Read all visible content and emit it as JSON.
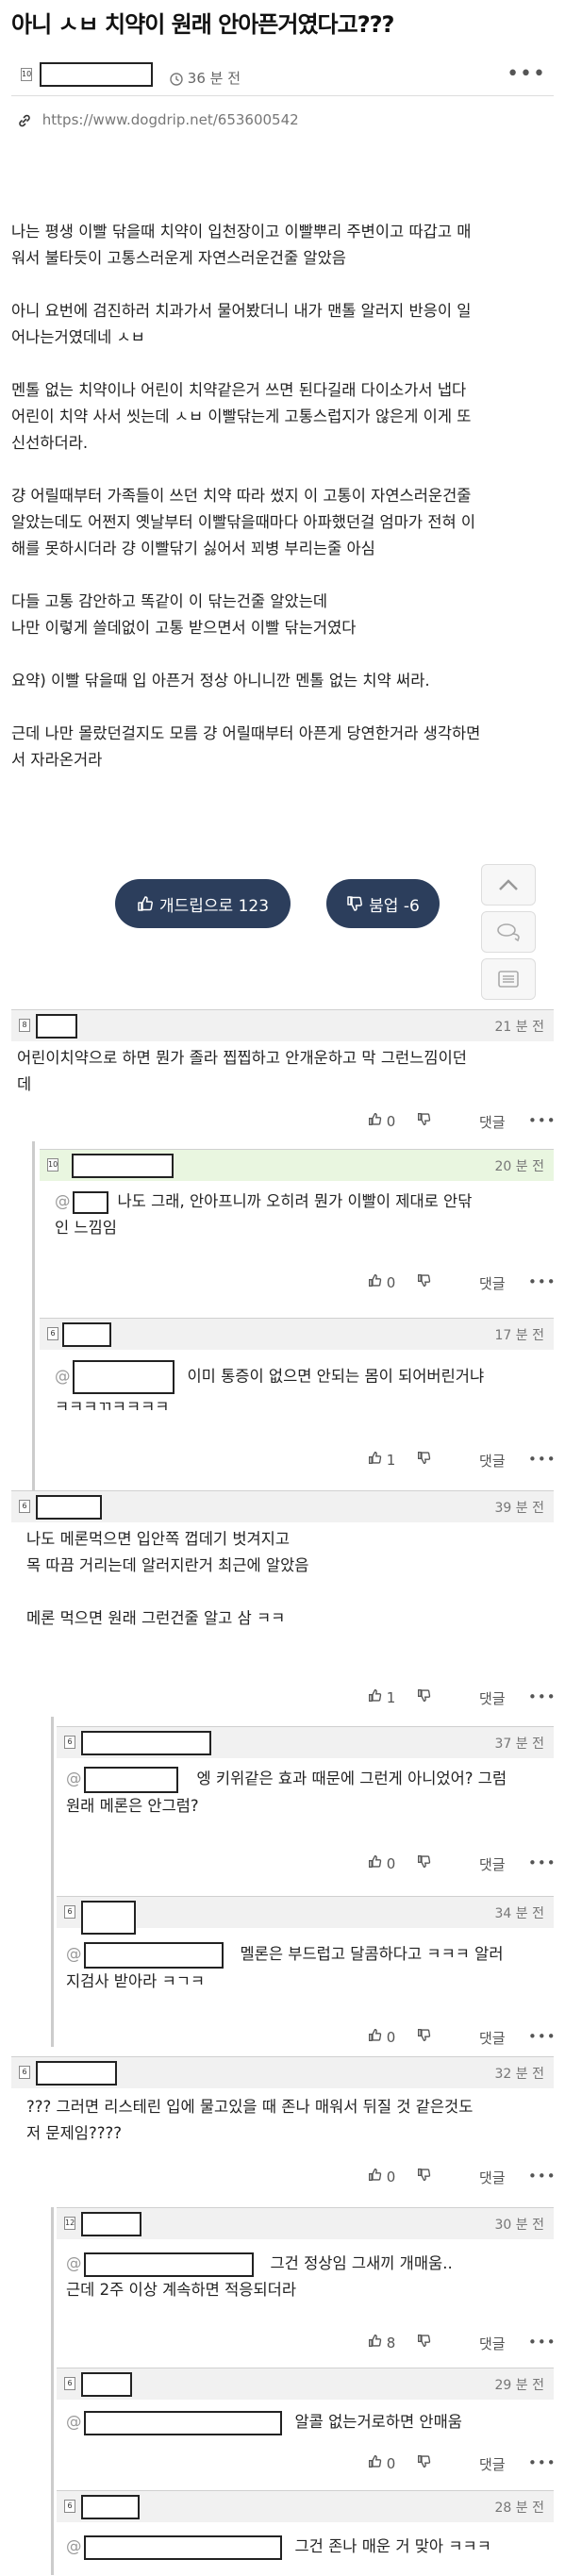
{
  "post": {
    "title": "아니 ㅅㅂ 치약이 원래 안아픈거였다고???",
    "level": "10",
    "time": "36 분 전",
    "url": "https://www.dogdrip.net/653600542",
    "paragraphs": [
      "나는 평생 이빨 닦을때 치약이 입천장이고 이빨뿌리 주변이고 따갑고 매\n워서 불타듯이 고통스러운게 자연스러운건줄 알았음",
      "아니 요번에 검진하러 치과가서 물어봤더니 내가 맨톨 알러지 반응이 일\n어나는거였데네 ㅅㅂ",
      "멘톨 없는 치약이나 어린이 치약같은거 쓰면 된다길래 다이소가서 냅다\n어린이 치약 사서 씻는데 ㅅㅂ 이빨닦는게 고통스럽지가 않은게 이게 또\n신선하더라.",
      "걍 어릴때부터 가족들이 쓰던 치약 따라 썼지 이 고통이 자연스러운건줄\n알았는데도 어쩐지 옛날부터 이빨닦을때마다 아파했던걸 엄마가 전혀 이\n해를 못하시더라 걍 이빨닦기 싫어서 꾀병 부리는줄 아심",
      "다들 고통 감안하고 똑같이 이 닦는건줄 알았는데\n나만 이렇게 쓸데없이 고통 받으면서 이빨 닦는거였다",
      "요약) 이빨 닦을때 입 아픈거 정상 아니니깐 멘톨 없는 치약 써라.",
      "근데 나만 몰랐던걸지도 모름 걍 어릴때부터 아픈게 당연한거라 생각하면\n서 자라온거라"
    ],
    "upvote_label": "개드립으로 123",
    "downvote_label": "붐업 -6"
  },
  "comments": [
    {
      "level": "8",
      "time": "21 분 전",
      "mention": "",
      "text": "어린이치약으로 하면 뭔가 졸라 찝찝하고 안개운하고 막 그런느낌이던\n데",
      "likes": "0",
      "reply_label": "댓글"
    },
    {
      "level": "10",
      "time": "20 분 전",
      "mention": "@",
      "text": "나도 그래, 안아프니까 오히려 뭔가 이빨이 제대로 안닦\n인 느낌임",
      "likes": "0",
      "reply_label": "댓글"
    },
    {
      "level": "6",
      "time": "17 분 전",
      "mention": "@",
      "text": "이미 통증이 없으면 안되는 몸이 되어버린거냐\nㅋㅋㅋㄲㅋㅋㅋㅋ",
      "likes": "1",
      "reply_label": "댓글"
    },
    {
      "level": "6",
      "time": "39 분 전",
      "mention": "",
      "text": "나도 메론먹으면 입안쪽 껍데기 벗겨지고\n목 따끔 거리는데 알러지란거 최근에 알았음\n\n메론 먹으면 원래 그런건줄 알고 삼 ㅋㅋ",
      "likes": "1",
      "reply_label": "댓글"
    },
    {
      "level": "6",
      "time": "37 분 전",
      "mention": "@",
      "text": "엥 키위같은 효과 때문에 그런게 아니었어? 그럼\n원래 메론은 안그럼?",
      "likes": "0",
      "reply_label": "댓글"
    },
    {
      "level": "6",
      "time": "34 분 전",
      "mention": "@",
      "text": "멜론은 부드럽고 달콤하다고 ㅋㅋㅋ 알러\n지검사 받아라 ㅋㄱㅋ",
      "likes": "0",
      "reply_label": "댓글"
    },
    {
      "level": "6",
      "time": "32 분 전",
      "mention": "",
      "text": "??? 그러면 리스테린 입에 물고있을 때 존나 매워서 뒤질 것 같은것도\n저 문제임????",
      "likes": "0",
      "reply_label": "댓글"
    },
    {
      "level": "12",
      "time": "30 분 전",
      "mention": "@",
      "text": "그건 정상임 그새끼 개매움..\n근데 2주 이상 계속하면 적응되더라",
      "likes": "8",
      "reply_label": "댓글"
    },
    {
      "level": "6",
      "time": "29 분 전",
      "mention": "@",
      "text": "알콜 없는거로하면 안매움",
      "likes": "0",
      "reply_label": "댓글"
    },
    {
      "level": "6",
      "time": "28 분 전",
      "mention": "@",
      "text": "그건 존나 매운 거 맞아 ㅋㅋㅋ",
      "likes": "",
      "reply_label": ""
    }
  ],
  "icons": {
    "clock": "clock-icon",
    "link": "link-icon",
    "thumb_up": "thumb-up-icon",
    "thumb_down": "thumb-down-icon",
    "more": "more-icon",
    "scroll_top": "chevron-up-icon",
    "comments": "comment-icon",
    "list": "list-icon"
  },
  "colors": {
    "vote_button": "#2c3e5c",
    "highlight_row": "#e9f6e0",
    "comment_header": "#f1f1f1"
  }
}
